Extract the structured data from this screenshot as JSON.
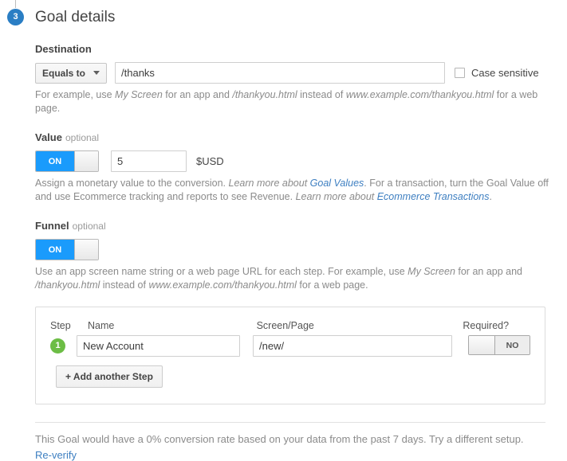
{
  "step_marker": {
    "number": "3",
    "color": "#2a7ec4"
  },
  "page_title": "Goal details",
  "destination": {
    "label": "Destination",
    "match_type": "Equals to",
    "value": "/thanks",
    "placeholder": "",
    "case_sensitive_label": "Case sensitive",
    "help": {
      "part1": "For example, use ",
      "em1": "My Screen",
      "part2": " for an app and ",
      "em2": "/thankyou.html",
      "part3": " instead of ",
      "em3": "www.example.com/thankyou.html",
      "part4": " for a web page."
    }
  },
  "value": {
    "label": "Value",
    "optional": "optional",
    "toggle_state": "ON",
    "amount": "5",
    "currency": "$USD",
    "help": {
      "part1": "Assign a monetary value to the conversion. ",
      "link1_prefix": "Learn more about ",
      "link1": "Goal Values",
      "part2": ". For a transaction, turn the Goal Value off and use Ecommerce tracking and reports to see Revenue. ",
      "link2_prefix": "Learn more about ",
      "link2": "Ecommerce Transactions",
      "part3": "."
    }
  },
  "funnel": {
    "label": "Funnel",
    "optional": "optional",
    "toggle_state": "ON",
    "help": {
      "part1": "Use an app screen name string or a web page URL for each step. For example, use ",
      "em1": "My Screen",
      "part2": " for an app and ",
      "em2": "/thankyou.html",
      "part3": " instead of ",
      "em3": "www.example.com/thankyou.html",
      "part4": " for a web page."
    },
    "columns": {
      "step": "Step",
      "name": "Name",
      "screen_page": "Screen/Page",
      "required": "Required?"
    },
    "steps": [
      {
        "number": "1",
        "name": "New Account",
        "screen_page": "/new/",
        "required_state": "NO",
        "badge_color": "#6cbd45"
      }
    ],
    "add_step_label": "+ Add another Step"
  },
  "footer": {
    "verification_text": "This Goal would have a 0% conversion rate based on your data from the past 7 days. Try a different setup.",
    "reverify_label": "Re-verify"
  }
}
